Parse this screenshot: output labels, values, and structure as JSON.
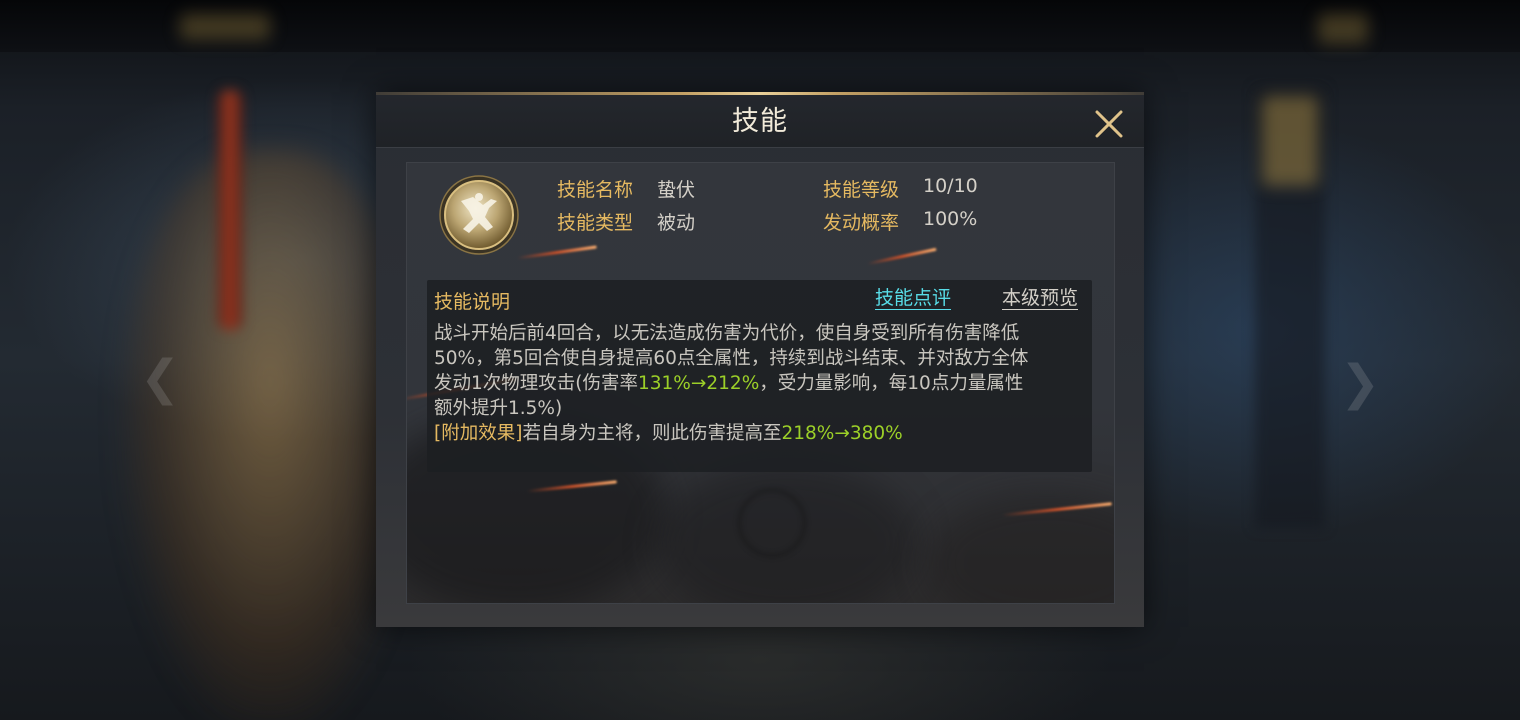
{
  "dialog": {
    "title": "技能",
    "close_icon": "close-x-icon"
  },
  "skill": {
    "icon": "dodge-figure-skill-icon",
    "name_label": "技能名称",
    "name_value": "蛰伏",
    "type_label": "技能类型",
    "type_value": "被动",
    "level_label": "技能等级",
    "level_value": "10/10",
    "rate_label": "发动概率",
    "rate_value": "100%"
  },
  "description": {
    "header": "技能说明",
    "review_link": "技能点评",
    "preview_link": "本级预览",
    "line1": "战斗开始后前4回合，以无法造成伤害为代价，使自身受到所有伤害降低",
    "line2": "50%，第5回合使自身提高60点全属性，持续到战斗结束、并对敌方全体",
    "line3_pre": "发动1次物理攻击(伤害率",
    "line3_hl": "131%→212%",
    "line3_post": "，受力量影响，每10点力量属性",
    "line4": "额外提升1.5%)",
    "line5_tag": "[附加效果]",
    "line5_pre": "若自身为主将，则此伤害提高至",
    "line5_hl": "218%→380%"
  },
  "colors": {
    "label_gold": "#e5b961",
    "value_text": "#d4d0c8",
    "highlight_green": "#9cd028",
    "link_cyan": "#58dce7"
  }
}
